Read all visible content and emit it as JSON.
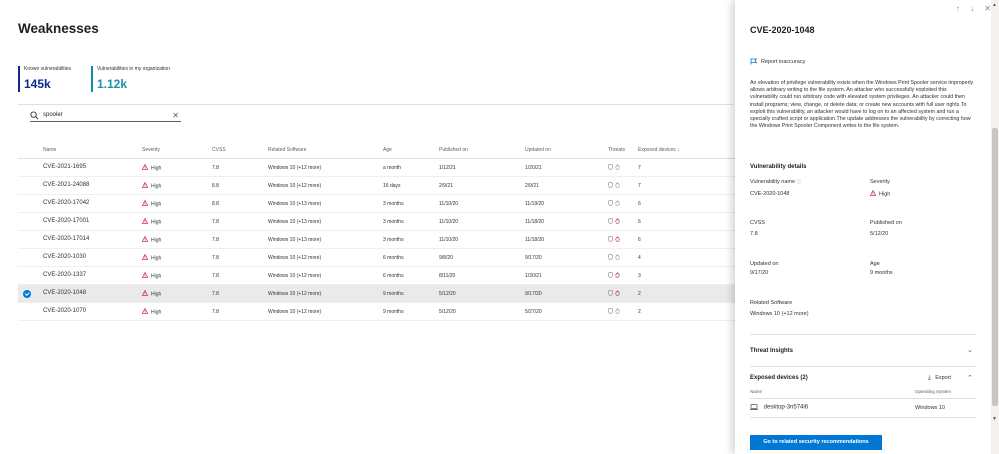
{
  "page": {
    "title": "Weaknesses"
  },
  "stats": [
    {
      "label": "Known vulnerabilities",
      "value": "145k",
      "color": "#0b2a8c"
    },
    {
      "label": "Vulnerabilities in my organization",
      "value": "1.12k",
      "color": "#1c8ea8"
    }
  ],
  "search": {
    "value": "spooler",
    "clear": "✕"
  },
  "table": {
    "columns": [
      "Name",
      "Severity",
      "CVSS",
      "Related Software",
      "Age",
      "Published on",
      "Updated on",
      "Threats",
      "Exposed devices ↓"
    ],
    "rows": [
      {
        "name": "CVE-2021-1695",
        "severity": "High",
        "cvss": "7.8",
        "software": "Windows 10 (+12 more)",
        "age": "a month",
        "published": "1/12/21",
        "updated": "1/20/21",
        "exposed": "7",
        "selected": false
      },
      {
        "name": "CVE-2021-24088",
        "severity": "High",
        "cvss": "8.8",
        "software": "Windows 10 (+12 more)",
        "age": "16 days",
        "published": "2/9/21",
        "updated": "2/9/21",
        "exposed": "7",
        "selected": false
      },
      {
        "name": "CVE-2020-17042",
        "severity": "High",
        "cvss": "8.8",
        "software": "Windows 10 (+13 more)",
        "age": "3 months",
        "published": "11/10/20",
        "updated": "11/19/20",
        "exposed": "6",
        "selected": false
      },
      {
        "name": "CVE-2020-17001",
        "severity": "High",
        "cvss": "7.8",
        "software": "Windows 10 (+13 more)",
        "age": "3 months",
        "published": "11/10/20",
        "updated": "11/18/20",
        "exposed": "6",
        "selected": false
      },
      {
        "name": "CVE-2020-17014",
        "severity": "High",
        "cvss": "7.8",
        "software": "Windows 10 (+13 more)",
        "age": "3 months",
        "published": "11/10/20",
        "updated": "11/18/20",
        "exposed": "6",
        "selected": false
      },
      {
        "name": "CVE-2020-1030",
        "severity": "High",
        "cvss": "7.8",
        "software": "Windows 10 (+12 more)",
        "age": "6 months",
        "published": "9/8/20",
        "updated": "9/17/20",
        "exposed": "4",
        "selected": false
      },
      {
        "name": "CVE-2020-1337",
        "severity": "High",
        "cvss": "7.8",
        "software": "Windows 10 (+12 more)",
        "age": "6 months",
        "published": "8/11/20",
        "updated": "1/30/21",
        "exposed": "3",
        "selected": false
      },
      {
        "name": "CVE-2020-1048",
        "severity": "High",
        "cvss": "7.8",
        "software": "Windows 10 (+12 more)",
        "age": "9 months",
        "published": "5/12/20",
        "updated": "9/17/20",
        "exposed": "2",
        "selected": true
      },
      {
        "name": "CVE-2020-1070",
        "severity": "High",
        "cvss": "7.8",
        "software": "Windows 10 (+12 more)",
        "age": "9 months",
        "published": "5/12/20",
        "updated": "5/27/20",
        "exposed": "2",
        "selected": false
      }
    ]
  },
  "panel": {
    "nav_up": "↑",
    "nav_down": "↓",
    "close": "✕",
    "title": "CVE-2020-1048",
    "report": "Report inaccuracy",
    "description": "An elevation of privilege vulnerability exists when the Windows Print Spooler service improperly allows arbitrary writing to the file system. An attacker who successfully exploited this vulnerability could run arbitrary code with elevated system privileges. An attacker could then install programs; view, change, or delete data; or create new accounts with full user rights.To exploit this vulnerability, an attacker would have to log on to an affected system and run a specially crafted script or application.The update addresses the vulnerability by correcting how the Windows Print Spooler Component writes to the file system.",
    "details_heading": "Vulnerability details",
    "details": {
      "name_label": "Vulnerability name",
      "name_value": "CVE-2020-1048",
      "severity_label": "Severity",
      "severity_value": "High",
      "cvss_label": "CVSS",
      "cvss_value": "7.8",
      "published_label": "Published on",
      "published_value": "5/12/20",
      "updated_label": "Updated on",
      "updated_value": "9/17/20",
      "age_label": "Age",
      "age_value": "9 months",
      "software_label": "Related Software",
      "software_value": "Windows 10 (+12 more)"
    },
    "threat_insights": "Threat Insights",
    "exposed_heading": "Exposed devices (2)",
    "export": "Export",
    "device_col_name": "Name",
    "device_col_os": "Operating System",
    "device_name": "desktop-3n574i6",
    "device_os": "Windows 10",
    "primary_button": "Go to related security recommendations"
  }
}
